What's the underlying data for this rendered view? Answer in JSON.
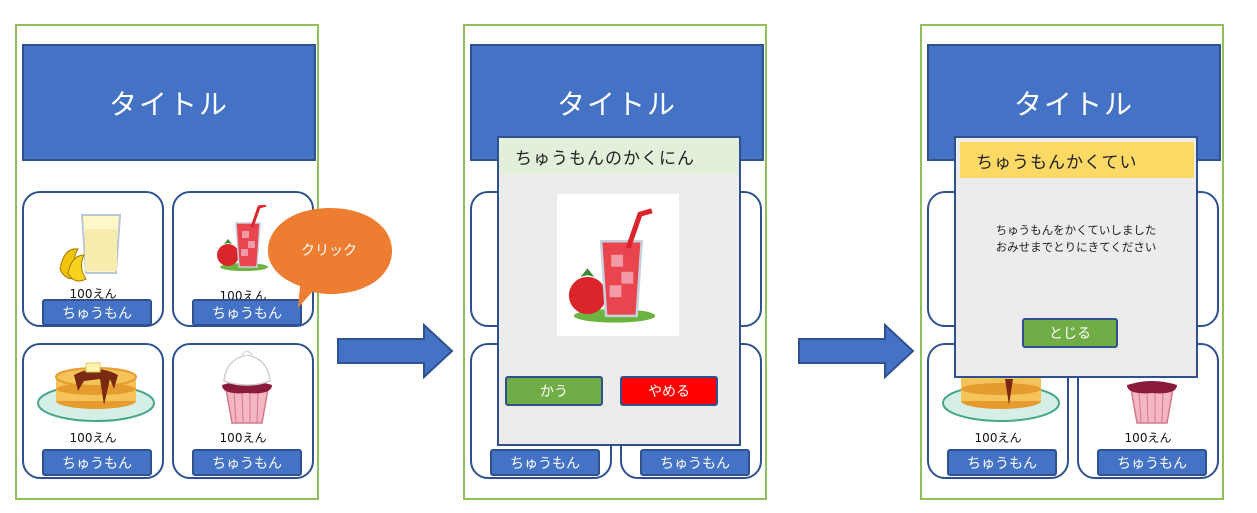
{
  "screens": [
    {
      "title": "タイトル",
      "items": [
        {
          "icon": "lemonade-banana",
          "price": "100えん",
          "button": "ちゅうもん"
        },
        {
          "icon": "tomato-juice",
          "price": "100えん",
          "button": "ちゅうもん"
        },
        {
          "icon": "pancake",
          "price": "100えん",
          "button": "ちゅうもん"
        },
        {
          "icon": "cupcake",
          "price": "100えん",
          "button": "ちゅうもん"
        }
      ]
    },
    {
      "title": "タイトル",
      "items": [
        {
          "button": "ちゅうもん"
        },
        {
          "button": "ちゅうもん"
        }
      ]
    },
    {
      "title": "タイトル",
      "items": [
        {
          "price": "100えん",
          "button": "ちゅうもん"
        },
        {
          "price": "100えん",
          "button": "ちゅうもん"
        }
      ]
    }
  ],
  "callout": {
    "label": "クリック",
    "color": "#ed7d31"
  },
  "confirm_dialog": {
    "heading": "ちゅうもんのかくにん",
    "image": "tomato-juice",
    "buy_label": "かう",
    "cancel_label": "やめる"
  },
  "done_dialog": {
    "heading": "ちゅうもんかくてい",
    "message_line1": "ちゅうもんをかくていしました",
    "message_line2": "おみせまでとりにきてください",
    "close_label": "とじる"
  },
  "colors": {
    "primary": "#4472c4",
    "frame": "#8fc05a",
    "buy": "#70ad47",
    "cancel": "#ff0000",
    "done_header": "#ffd966",
    "confirm_header": "#e2efda"
  }
}
